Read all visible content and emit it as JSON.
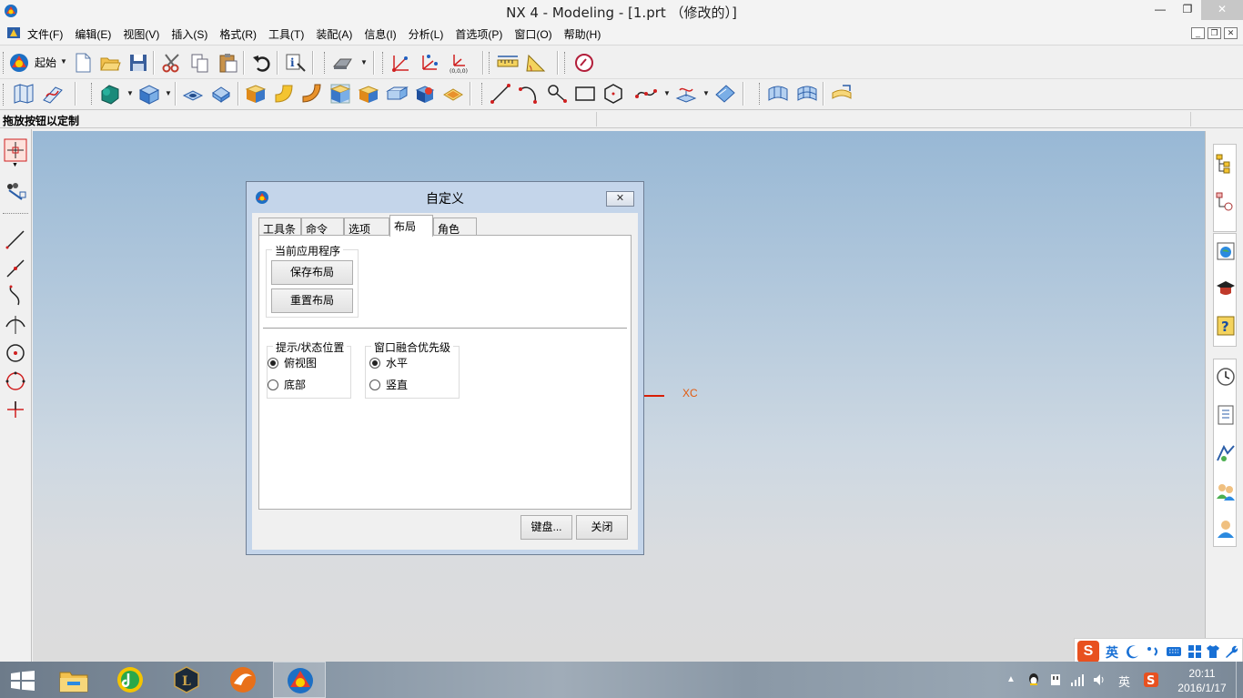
{
  "window": {
    "title": "NX 4 - Modeling - [1.prt （修改的）]",
    "buttons": {
      "minimize": "—",
      "restore": "❐",
      "close": "✕"
    }
  },
  "menubar": {
    "items": [
      "文件(F)",
      "编辑(E)",
      "视图(V)",
      "插入(S)",
      "格式(R)",
      "工具(T)",
      "装配(A)",
      "信息(I)",
      "分析(L)",
      "首选项(P)",
      "窗口(O)",
      "帮助(H)"
    ]
  },
  "toolbar": {
    "start_label": "起始",
    "cue_line": "拖放按钮以定制"
  },
  "graphics": {
    "axis_label": "XC"
  },
  "dialog": {
    "title": "自定义",
    "close_glyph": "✕",
    "tabs": [
      "工具条",
      "命令",
      "选项",
      "布局",
      "角色"
    ],
    "active_tab": "布局",
    "group_current_app": {
      "label": "当前应用程序",
      "save_layout": "保存布局",
      "reset_layout": "重置布局"
    },
    "group_prompt": {
      "label": "提示/状态位置",
      "options": [
        "俯视图",
        "底部"
      ],
      "selected": "俯视图"
    },
    "group_window": {
      "label": "窗口融合优先级",
      "options": [
        "水平",
        "竖直"
      ],
      "selected": "水平"
    },
    "keyboard_button": "键盘...",
    "close_button": "关闭"
  },
  "ime": {
    "logo": "S",
    "mode": "英"
  },
  "taskbar": {
    "tray_lang": "英",
    "time": "20:11",
    "date": "2016/1/17"
  },
  "colors": {
    "axis_red": "#d81e05",
    "axis_label": "#e25a0e",
    "dialog_frame": "#c4d5ea"
  }
}
